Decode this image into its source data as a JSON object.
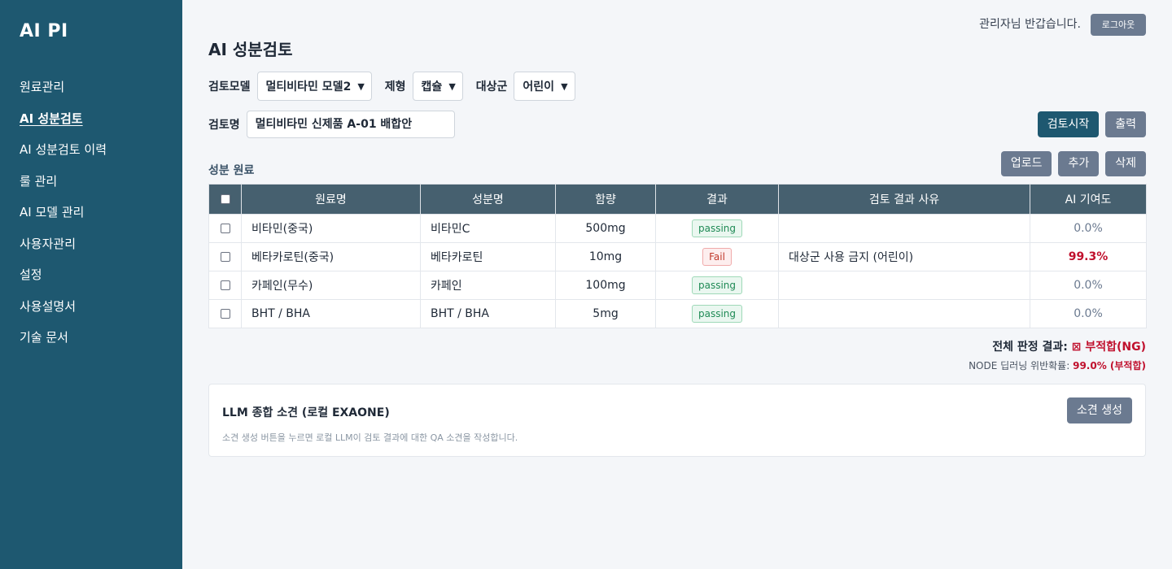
{
  "sidebar": {
    "brand": "AI PI",
    "items": [
      {
        "label": "원료관리",
        "active": false
      },
      {
        "label": "AI 성분검토",
        "active": true
      },
      {
        "label": "AI 성분검토 이력",
        "active": false
      },
      {
        "label": "룰 관리",
        "active": false
      },
      {
        "label": "AI 모델 관리",
        "active": false
      },
      {
        "label": "사용자관리",
        "active": false
      },
      {
        "label": "설정",
        "active": false
      },
      {
        "label": "사용설명서",
        "active": false
      },
      {
        "label": "기술 문서",
        "active": false
      }
    ]
  },
  "header": {
    "greeting": "관리자님 반갑습니다.",
    "logout_label": "로그아웃"
  },
  "page": {
    "title": "AI 성분검토"
  },
  "filters": {
    "model_label": "검토모델",
    "model_value": "멀티비타민 모델2",
    "form_label": "제형",
    "form_value": "캡슐",
    "target_label": "대상군",
    "target_value": "어린이"
  },
  "review": {
    "name_label": "검토명",
    "name_value": "멀티비타민 신제품 A-01 배합안",
    "start_label": "검토시작",
    "print_label": "출력"
  },
  "ingredients": {
    "section_label": "성분 원료",
    "upload_label": "업로드",
    "add_label": "추가",
    "delete_label": "삭제",
    "columns": [
      "원료명",
      "성분명",
      "함량",
      "결과",
      "검토 결과 사유",
      "AI 기여도"
    ],
    "rows": [
      {
        "material": "비타민(중국)",
        "component": "비타민C",
        "amount": "500mg",
        "result": "passing",
        "reason": "",
        "contribution": "0.0%"
      },
      {
        "material": "베타카로틴(중국)",
        "component": "베타카로틴",
        "amount": "10mg",
        "result": "Fail",
        "reason": "대상군 사용 금지 (어린이)",
        "contribution": "99.3%"
      },
      {
        "material": "카페인(무수)",
        "component": "카페인",
        "amount": "100mg",
        "result": "passing",
        "reason": "",
        "contribution": "0.0%"
      },
      {
        "material": "BHT / BHA",
        "component": "BHT / BHA",
        "amount": "5mg",
        "result": "passing",
        "reason": "",
        "contribution": "0.0%"
      }
    ]
  },
  "summary": {
    "overall_label": "전체 판정 결과:",
    "overall_value": "⊠ 부적합(NG)",
    "node_label": "NODE 딥러닝 위반확률:",
    "node_value": "99.0% (부적합)"
  },
  "llm": {
    "title": "LLM 종합 소견 (로컬 EXAONE)",
    "button_label": "소견 생성",
    "description": "소견 생성 버튼을 누르면 로컬 LLM이 검토 결과에 대한 QA 소견을 작성합니다."
  },
  "colors": {
    "sidebar_bg": "#1e5870",
    "header_bg": "#46606f",
    "ng": "#c0102d",
    "pass": "#1f8a55"
  }
}
